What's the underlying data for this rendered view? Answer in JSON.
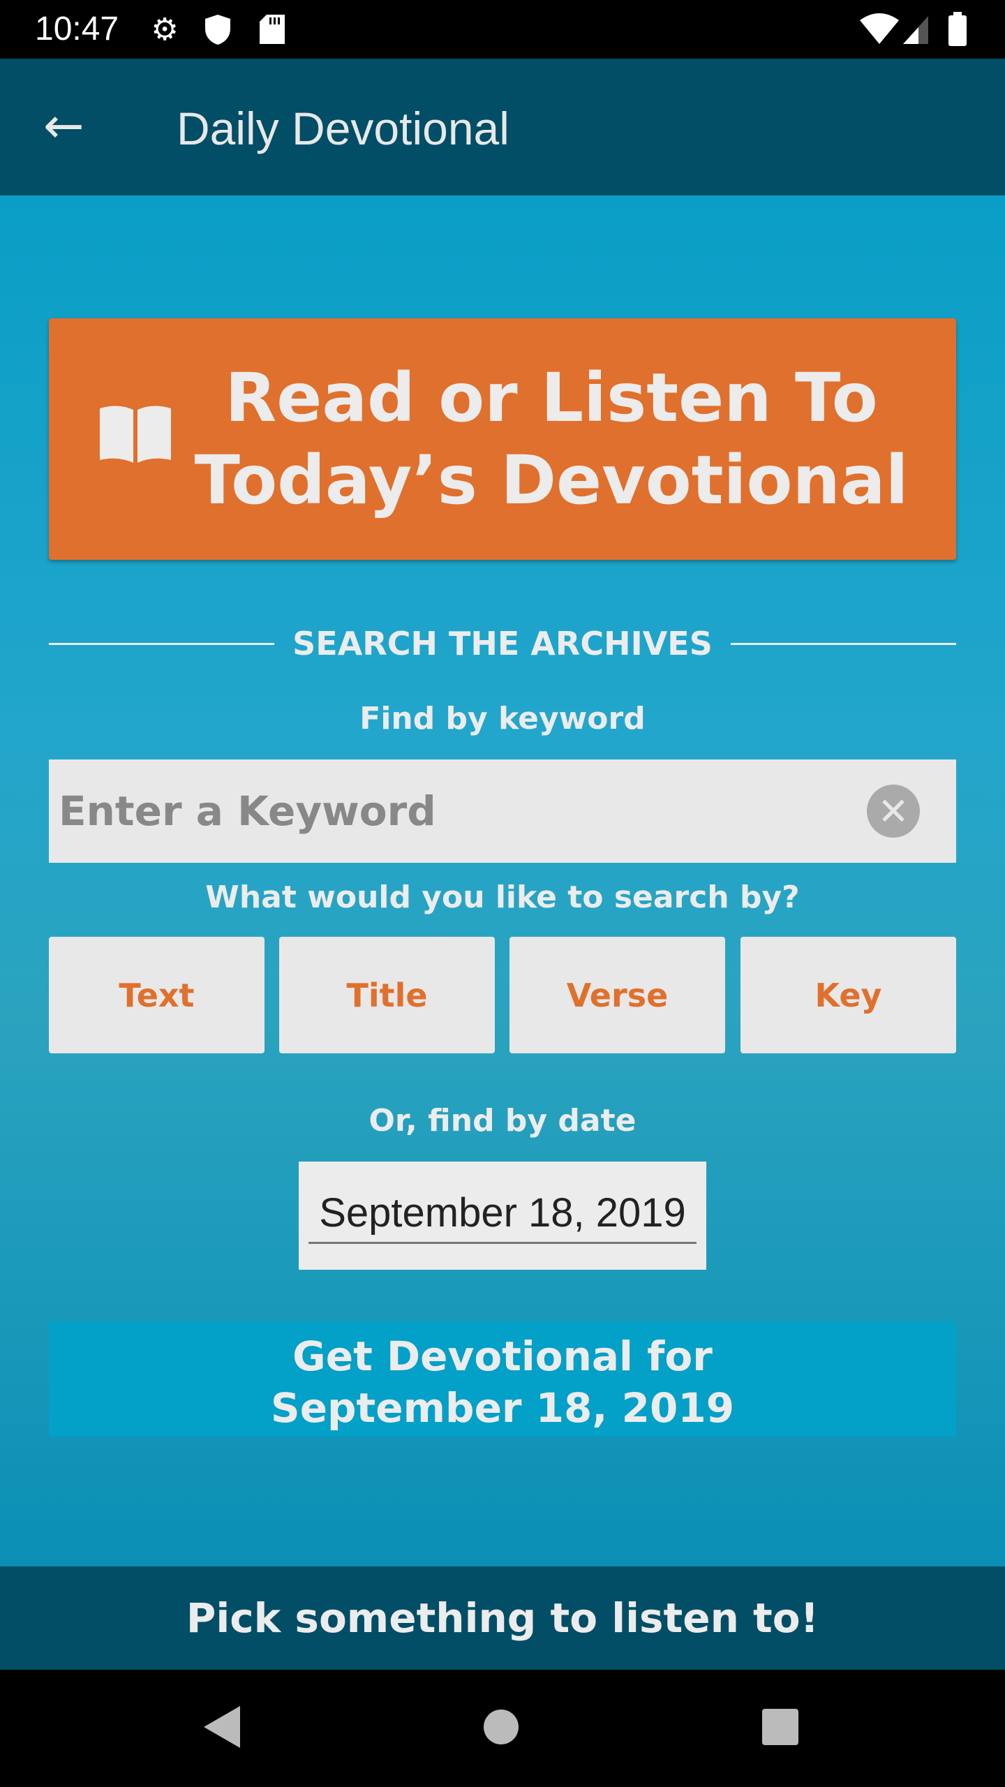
{
  "status_bar": {
    "time": "10:47",
    "icons": [
      "gear-icon",
      "shield-icon",
      "sd-card-icon",
      "wifi-icon",
      "signal-icon",
      "battery-icon"
    ]
  },
  "app_bar": {
    "title": "Daily Devotional",
    "back_icon": "arrow-left-icon"
  },
  "hero_button": {
    "line1": "Read or Listen To",
    "line2": "Today’s Devotional",
    "icon": "open-book-icon",
    "color": "#e0702d"
  },
  "search": {
    "section_title": "SEARCH THE ARCHIVES",
    "keyword_label": "Find by keyword",
    "keyword_placeholder": "Enter a Keyword",
    "keyword_value": "",
    "search_by_label": "What would you like to search by?",
    "options": [
      "Text",
      "Title",
      "Verse",
      "Key"
    ]
  },
  "date": {
    "label": "Or, find by date",
    "value": "September 18, 2019"
  },
  "get_button": {
    "line1": "Get Devotional for",
    "line2": "September 18, 2019"
  },
  "bottom_bar": {
    "label": "Pick something to listen to!"
  },
  "colors": {
    "appbar": "#014e66",
    "accent": "#e0702d",
    "button_blue": "#03a0c8"
  }
}
